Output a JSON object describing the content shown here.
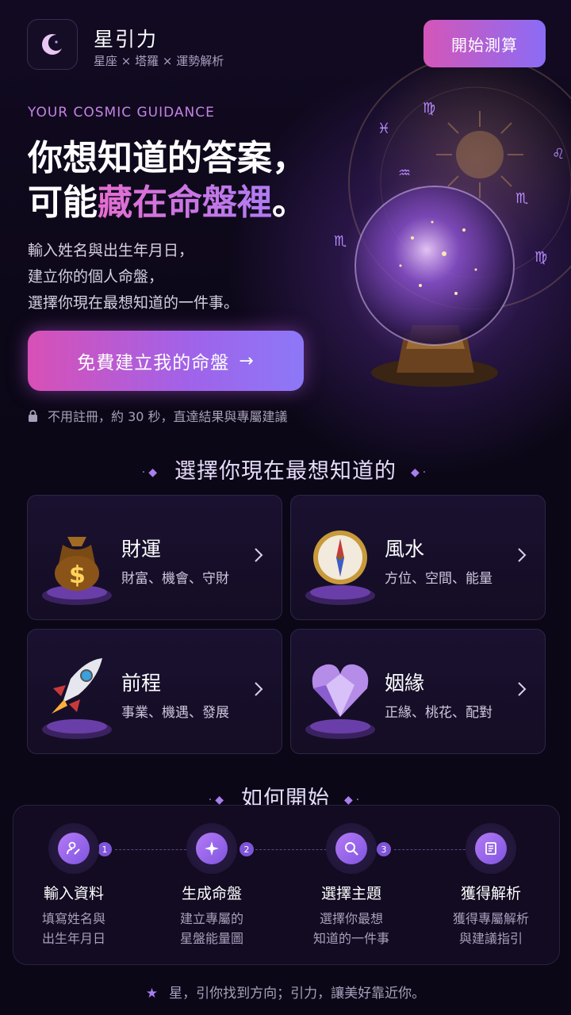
{
  "header": {
    "brand_title": "星引力",
    "brand_subtitle": "星座 × 塔羅 × 運勢解析",
    "start_button": "開始測算"
  },
  "hero": {
    "tagline": "YOUR COSMIC GUIDANCE",
    "headline_line1": "你想知道的答案，",
    "headline_line2_prefix": "可能",
    "headline_line2_highlight": "藏在命盤裡",
    "headline_line2_suffix": "。",
    "desc_lines": [
      "輸入姓名與出生年月日，",
      "建立你的個人命盤，",
      "選擇你現在最想知道的一件事。"
    ],
    "cta_label": "免費建立我的命盤",
    "cta_arrow": "→",
    "note": "不用註冊，約 30 秒，直達結果與專屬建議"
  },
  "topics": {
    "section_title": "選擇你現在最想知道的",
    "items": [
      {
        "title": "財運",
        "subtitle": "財富、機會、守財",
        "icon": "money-bag-icon"
      },
      {
        "title": "風水",
        "subtitle": "方位、空間、能量",
        "icon": "compass-icon"
      },
      {
        "title": "前程",
        "subtitle": "事業、機遇、發展",
        "icon": "rocket-icon"
      },
      {
        "title": "姻緣",
        "subtitle": "正緣、桃花、配對",
        "icon": "heart-gem-icon"
      }
    ]
  },
  "how": {
    "section_title": "如何開始",
    "steps": [
      {
        "number": "1",
        "title": "輸入資料",
        "desc_line1": "填寫姓名與",
        "desc_line2": "出生年月日"
      },
      {
        "number": "2",
        "title": "生成命盤",
        "desc_line1": "建立專屬的",
        "desc_line2": "星盤能量圖"
      },
      {
        "number": "3",
        "title": "選擇主題",
        "desc_line1": "選擇你最想",
        "desc_line2": "知道的一件事"
      },
      {
        "title": "獲得解析",
        "desc_line1": "獲得專屬解析",
        "desc_line2": "與建議指引"
      }
    ]
  },
  "footer": {
    "text": "星，引你找到方向；引力，讓美好靠近你。"
  },
  "colors": {
    "background": "#0b0716",
    "accent_pink": "#d456b8",
    "accent_purple": "#8a6cf5",
    "tagline": "#c583e6"
  }
}
